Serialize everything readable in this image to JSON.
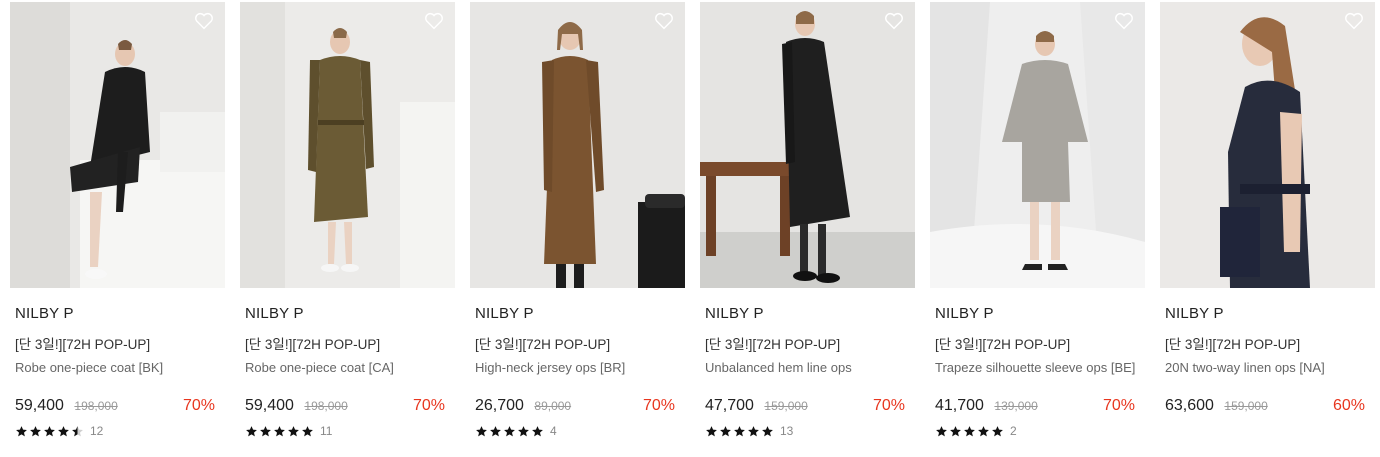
{
  "colors": {
    "discount": "#e8361f",
    "star": "#111111",
    "original_price": "#999999"
  },
  "products": [
    {
      "brand": "NILBY P",
      "tag": "[단 3일!][72H POP-UP]",
      "name": "Robe one-piece coat [BK]",
      "price": "59,400",
      "original_price": "198,000",
      "discount": "70%",
      "rating": 4.5,
      "review_count": "12",
      "wish_icon": "heart-outline-icon"
    },
    {
      "brand": "NILBY P",
      "tag": "[단 3일!][72H POP-UP]",
      "name": "Robe one-piece coat [CA]",
      "price": "59,400",
      "original_price": "198,000",
      "discount": "70%",
      "rating": 5,
      "review_count": "11",
      "wish_icon": "heart-outline-icon"
    },
    {
      "brand": "NILBY P",
      "tag": "[단 3일!][72H POP-UP]",
      "name": "High-neck jersey ops [BR]",
      "price": "26,700",
      "original_price": "89,000",
      "discount": "70%",
      "rating": 5,
      "review_count": "4",
      "wish_icon": "heart-outline-icon"
    },
    {
      "brand": "NILBY P",
      "tag": "[단 3일!][72H POP-UP]",
      "name": "Unbalanced hem line ops",
      "price": "47,700",
      "original_price": "159,000",
      "discount": "70%",
      "rating": 5,
      "review_count": "13",
      "wish_icon": "heart-outline-icon"
    },
    {
      "brand": "NILBY P",
      "tag": "[단 3일!][72H POP-UP]",
      "name": "Trapeze silhouette sleeve ops [BE]",
      "price": "41,700",
      "original_price": "139,000",
      "discount": "70%",
      "rating": 5,
      "review_count": "2",
      "wish_icon": "heart-outline-icon"
    },
    {
      "brand": "NILBY P",
      "tag": "[단 3일!][72H POP-UP]",
      "name": "20N two-way linen ops [NA]",
      "price": "63,600",
      "original_price": "159,000",
      "discount": "60%",
      "rating": null,
      "review_count": null,
      "wish_icon": "heart-outline-icon"
    }
  ]
}
